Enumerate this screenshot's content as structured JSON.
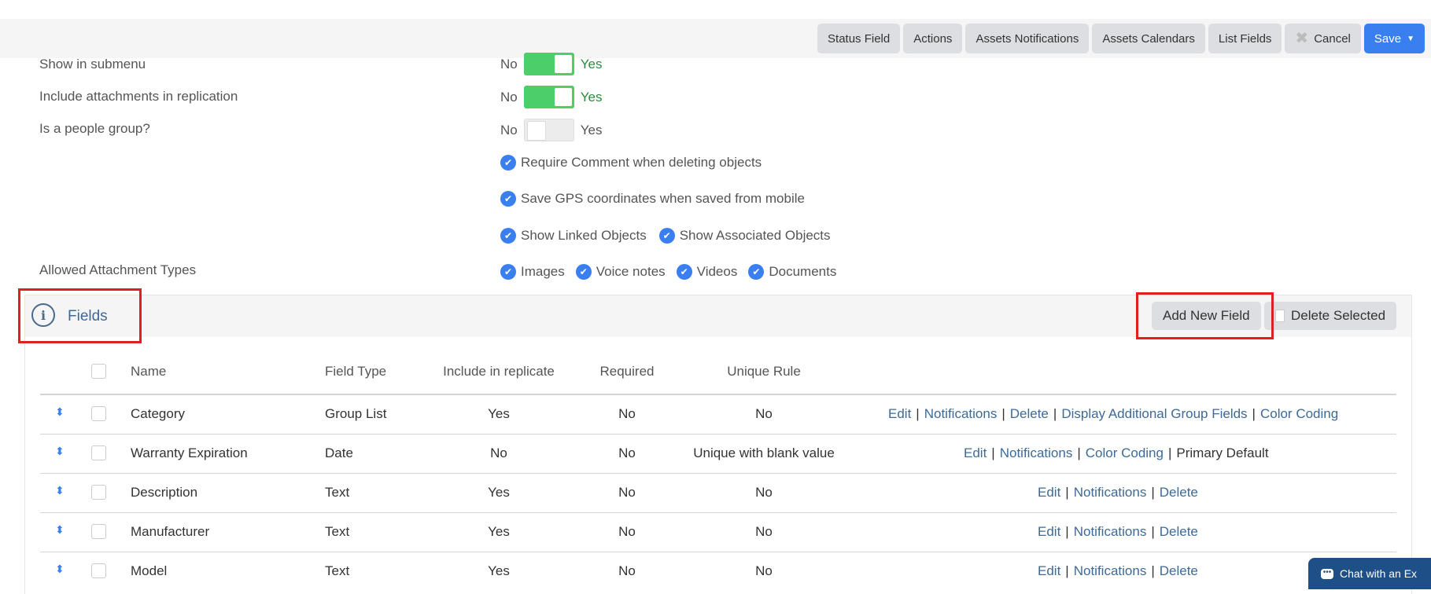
{
  "toolbar": {
    "buttons": [
      "Status Field",
      "Actions",
      "Assets Notifications",
      "Assets Calendars",
      "List Fields"
    ],
    "cancel_label": "Cancel",
    "save_label": "Save"
  },
  "settings": {
    "show_in_submenu": {
      "label": "Show in submenu",
      "no": "No",
      "yes": "Yes",
      "on": true
    },
    "include_attachments": {
      "label": "Include attachments in replication",
      "no": "No",
      "yes": "Yes",
      "on": true
    },
    "people_group": {
      "label": "Is a people group?",
      "no": "No",
      "yes": "Yes",
      "on": false
    },
    "require_comment": "Require Comment when deleting objects",
    "save_gps": "Save GPS coordinates when saved from mobile",
    "show_linked": "Show Linked Objects",
    "show_associated": "Show Associated Objects",
    "allowed_types_label": "Allowed Attachment Types",
    "attachment_types": [
      "Images",
      "Voice notes",
      "Videos",
      "Documents"
    ]
  },
  "fields_panel": {
    "title": "Fields",
    "add_button": "Add New Field",
    "delete_button": "Delete Selected"
  },
  "table": {
    "headers": {
      "name": "Name",
      "field_type": "Field Type",
      "include": "Include in replicate",
      "required": "Required",
      "unique": "Unique Rule"
    },
    "rows": [
      {
        "name": "Category",
        "type": "Group List",
        "include": "Yes",
        "required": "No",
        "unique": "No",
        "actions": [
          "Edit",
          "Notifications",
          "Delete",
          "Display Additional Group Fields",
          "Color Coding"
        ],
        "extra": ""
      },
      {
        "name": "Warranty Expiration",
        "type": "Date",
        "include": "No",
        "required": "No",
        "unique": "Unique with blank value",
        "actions": [
          "Edit",
          "Notifications",
          "Color Coding"
        ],
        "extra": "Primary Default"
      },
      {
        "name": "Description",
        "type": "Text",
        "include": "Yes",
        "required": "No",
        "unique": "No",
        "actions": [
          "Edit",
          "Notifications",
          "Delete"
        ],
        "extra": ""
      },
      {
        "name": "Manufacturer",
        "type": "Text",
        "include": "Yes",
        "required": "No",
        "unique": "No",
        "actions": [
          "Edit",
          "Notifications",
          "Delete"
        ],
        "extra": ""
      },
      {
        "name": "Model",
        "type": "Text",
        "include": "Yes",
        "required": "No",
        "unique": "No",
        "actions": [
          "Edit",
          "Notifications",
          "Delete"
        ],
        "extra": ""
      }
    ]
  },
  "chat": {
    "label": "Chat with an Ex"
  }
}
